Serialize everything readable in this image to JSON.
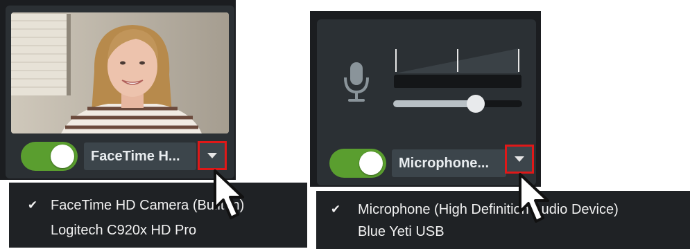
{
  "camera": {
    "device_label": "FaceTime H...",
    "toggle_on": true,
    "menu_items": [
      {
        "label": "FaceTime HD Camera (Built-in)",
        "checked": true
      },
      {
        "label": "Logitech C920x HD Pro",
        "checked": false
      }
    ]
  },
  "microphone": {
    "device_label": "Microphone...",
    "toggle_on": true,
    "volume_level": 0.78,
    "menu_items": [
      {
        "label": "Microphone (High Definition Audio Device)",
        "checked": true
      },
      {
        "label": "Blue Yeti USB",
        "checked": false
      }
    ]
  },
  "icons": {
    "check": "checkmark-icon",
    "microphone": "microphone-icon",
    "dropdown": "chevron-down-icon",
    "cursor": "mouse-pointer-icon"
  },
  "colors": {
    "toggle_on": "#5a9e2f",
    "highlight": "#e01818",
    "panel_bg": "#1b1d20",
    "card_bg": "#2b3034"
  }
}
